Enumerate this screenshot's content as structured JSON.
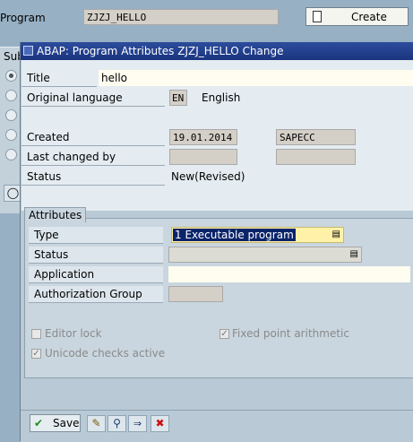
{
  "background_screen": {
    "program_label": "Program",
    "program_value": "ZJZJ_HELLO",
    "create_button": "Create",
    "subobjects_label": "Sub"
  },
  "dialog": {
    "title": "ABAP: Program Attributes ZJZJ_HELLO Change",
    "title_label": "Title",
    "title_value": "hello",
    "original_language_label": "Original language",
    "original_language_code": "EN",
    "original_language_name": "English",
    "created_label": "Created",
    "created_date": "19.01.2014",
    "created_by": "SAPECC",
    "last_changed_label": "Last changed by",
    "last_changed_date": "",
    "last_changed_by": "",
    "status_label": "Status",
    "status_value": "New(Revised)",
    "attributes": {
      "tab_label": "Attributes",
      "type_label": "Type",
      "type_value": "1 Executable program",
      "status_label": "Status",
      "status_value": "",
      "application_label": "Application",
      "application_value": "",
      "authorization_group_label": "Authorization Group",
      "authorization_group_value": "",
      "editor_lock_label": "Editor lock",
      "editor_lock_checked": false,
      "fixed_point_label": "Fixed point arithmetic",
      "fixed_point_checked": true,
      "unicode_label": "Unicode checks active",
      "unicode_checked": true
    },
    "footer": {
      "save_label": "Save"
    }
  },
  "colors": {
    "screen_bg": "#97b0c3",
    "dialog_title_bg": "#1f3f8f",
    "selection_bg": "#0a246a",
    "dropdown_bg": "#fff2a8"
  }
}
